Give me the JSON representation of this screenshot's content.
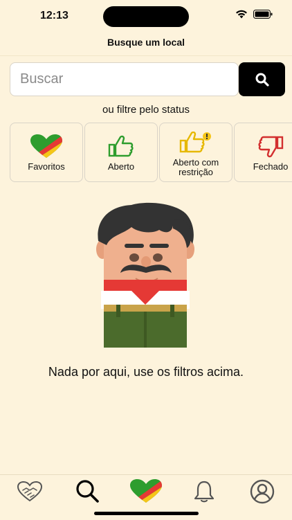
{
  "status": {
    "time": "12:13"
  },
  "header": {
    "title": "Busque um local"
  },
  "search": {
    "placeholder": "Buscar"
  },
  "subtitle": "ou filtre pelo status",
  "filters": [
    {
      "label": "Favoritos",
      "icon": "heart-flag-icon"
    },
    {
      "label": "Aberto",
      "icon": "thumbs-up-icon",
      "color": "#2e9d2e"
    },
    {
      "label": "Aberto com restrição",
      "icon": "thumbs-up-warning-icon",
      "color": "#e6b800"
    },
    {
      "label": "Fechado",
      "icon": "thumbs-down-icon",
      "color": "#d32f2f"
    }
  ],
  "empty_state": {
    "message": "Nada por aqui, use os filtros acima."
  },
  "tabbar": [
    {
      "icon": "handshake-icon"
    },
    {
      "icon": "search-icon",
      "active": true
    },
    {
      "icon": "heart-flag-icon"
    },
    {
      "icon": "bell-icon"
    },
    {
      "icon": "profile-icon"
    }
  ],
  "colors": {
    "background": "#fdf3dc",
    "flag_green": "#2e9d2e",
    "flag_red": "#e53935",
    "flag_yellow": "#f5c518"
  }
}
